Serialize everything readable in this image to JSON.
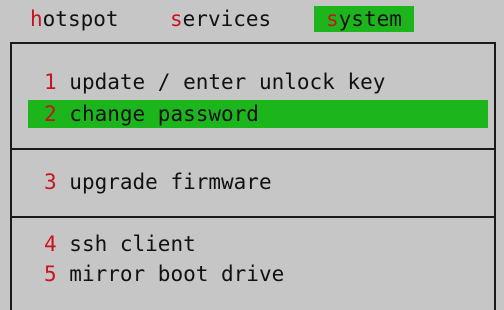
{
  "menubar": {
    "items": [
      {
        "hot": "h",
        "rest": "otspot",
        "active": false
      },
      {
        "hot": "s",
        "rest": "ervices",
        "active": false
      },
      {
        "hot": "s",
        "rest": "ystem",
        "active": true
      }
    ]
  },
  "system_menu": {
    "options": [
      {
        "number": "1",
        "label": " update / enter unlock key",
        "selected": false
      },
      {
        "number": "2",
        "label": " change password",
        "selected": true
      },
      {
        "number": "3",
        "label": " upgrade firmware",
        "selected": false
      },
      {
        "number": "4",
        "label": " ssh client",
        "selected": false
      },
      {
        "number": "5",
        "label": " mirror boot drive",
        "selected": false
      }
    ]
  },
  "colors": {
    "background": "#c6c6c6",
    "highlight": "#1cb51c",
    "hotkey": "#c8141e",
    "text": "#111111"
  }
}
